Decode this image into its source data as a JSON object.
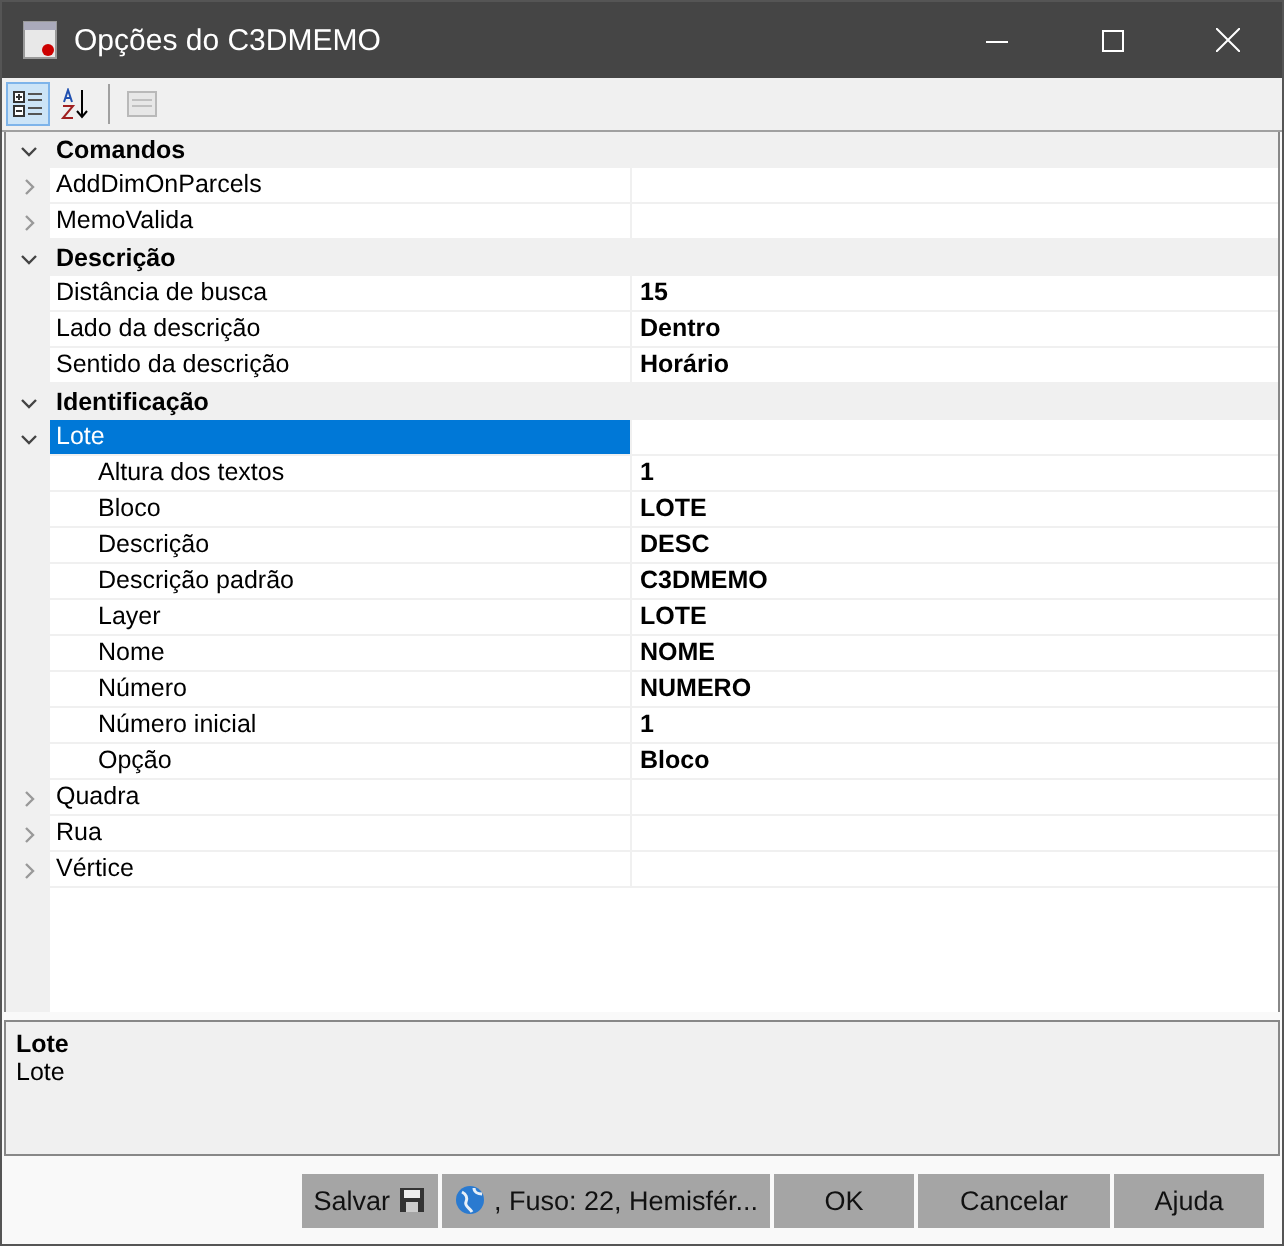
{
  "window": {
    "title": "Opções do C3DMEMO"
  },
  "toolbar": [
    {
      "kind": "categorized",
      "selected": true,
      "disabled": false
    },
    {
      "kind": "alphabetical",
      "selected": false,
      "disabled": false
    },
    {
      "kind": "pages",
      "selected": false,
      "disabled": true
    }
  ],
  "categories": [
    {
      "name": "Comandos",
      "expanded": true,
      "items": [
        {
          "name": "AddDimOnParcels",
          "expanded": false,
          "selected": false
        },
        {
          "name": "MemoValida",
          "expanded": false,
          "selected": false
        }
      ]
    },
    {
      "name": "Descrição",
      "expanded": true,
      "items": [
        {
          "name": "Distância de busca",
          "value": "15",
          "selected": false
        },
        {
          "name": "Lado da descrição",
          "value": "Dentro",
          "selected": false
        },
        {
          "name": "Sentido da descrição",
          "value": "Horário",
          "selected": false
        }
      ]
    },
    {
      "name": "Identificação",
      "expanded": true,
      "items": [
        {
          "name": "Lote",
          "expanded": true,
          "selected": true,
          "children": [
            {
              "name": "Altura dos textos",
              "value": "1",
              "selected": false
            },
            {
              "name": "Bloco",
              "value": "LOTE",
              "selected": false
            },
            {
              "name": "Descrição",
              "value": "DESC",
              "selected": false
            },
            {
              "name": "Descrição padrão",
              "value": "C3DMEMO",
              "selected": false
            },
            {
              "name": "Layer",
              "value": "LOTE",
              "selected": false
            },
            {
              "name": "Nome",
              "value": "NOME",
              "selected": false
            },
            {
              "name": "Número",
              "value": "NUMERO",
              "selected": false
            },
            {
              "name": "Número inicial",
              "value": "1",
              "selected": false
            },
            {
              "name": "Opção",
              "value": "Bloco",
              "selected": false
            }
          ]
        },
        {
          "name": "Quadra",
          "expanded": false,
          "selected": false
        },
        {
          "name": "Rua",
          "expanded": false,
          "selected": false
        },
        {
          "name": "Vértice",
          "expanded": false,
          "selected": false
        }
      ]
    }
  ],
  "description": {
    "title": "Lote",
    "text": "Lote"
  },
  "buttons": [
    {
      "kind": "save",
      "label": "Salvar"
    },
    {
      "kind": "zone",
      "label": ", Fuso: 22, Hemisfér..."
    },
    {
      "kind": "plain",
      "label": "OK"
    },
    {
      "kind": "plain",
      "label": "Cancelar"
    },
    {
      "kind": "plain",
      "label": "Ajuda"
    }
  ]
}
